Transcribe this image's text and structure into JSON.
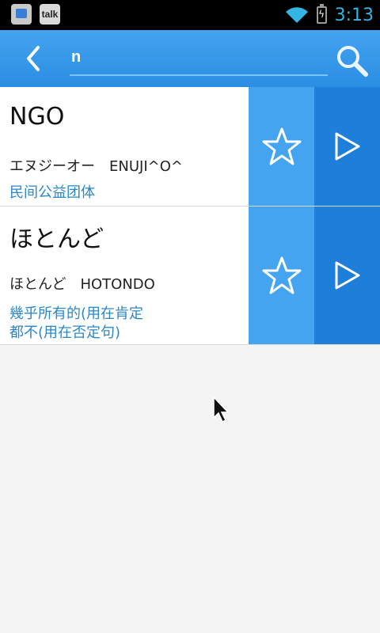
{
  "status_bar": {
    "time": "3:13",
    "apps": [
      "gallery",
      "talk"
    ],
    "talk_label": "talk",
    "icons": [
      "wifi-icon",
      "battery-charging-icon"
    ]
  },
  "appbar": {
    "search_value": "n",
    "icons": [
      "back-arrow-icon",
      "search-icon"
    ],
    "colors": {
      "bar": "#2a8ee3",
      "accent": "#33b5e5"
    }
  },
  "results": [
    {
      "word": "NGO",
      "reading": "エヌジーオー　ENUJI^O^",
      "meaning": "民间公益团体"
    },
    {
      "word": "ほとんど",
      "reading": "ほとんど　HOTONDO",
      "meaning": "幾乎所有的(用在肯定\n都不(用在否定句)"
    }
  ],
  "row_icons": [
    "star-outline-icon",
    "play-triangle-icon"
  ]
}
